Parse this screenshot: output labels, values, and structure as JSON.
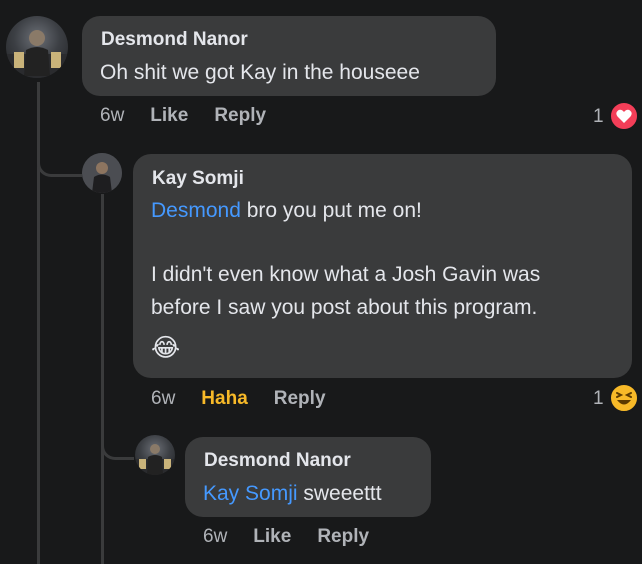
{
  "comments": [
    {
      "author": "Desmond Nanor",
      "text": "Oh shit we got Kay in the houseee",
      "time": "6w",
      "action_label": "Like",
      "reply_label": "Reply",
      "reaction_count": "1",
      "reaction_icon": "heart-icon",
      "reaction_color": "#f33e58"
    },
    {
      "author": "Kay Somji",
      "mention": "Desmond",
      "line1_rest": " bro you put me on!",
      "line2": "I didn't even know what a Josh Gavin was",
      "line3": "before I saw you post about this program.",
      "emoji": "😂",
      "time": "6w",
      "action_label": "Haha",
      "reply_label": "Reply",
      "reaction_count": "1",
      "reaction_icon": "laughing-face-icon",
      "reaction_color": "#f7b928"
    },
    {
      "author": "Desmond Nanor",
      "mention": "Kay Somji",
      "text_rest": " sweeettt",
      "time": "6w",
      "action_label": "Like",
      "reply_label": "Reply"
    }
  ],
  "colors": {
    "background": "#18191a",
    "bubble": "#3a3b3c",
    "mention": "#4599ff",
    "haha": "#f7b928"
  }
}
